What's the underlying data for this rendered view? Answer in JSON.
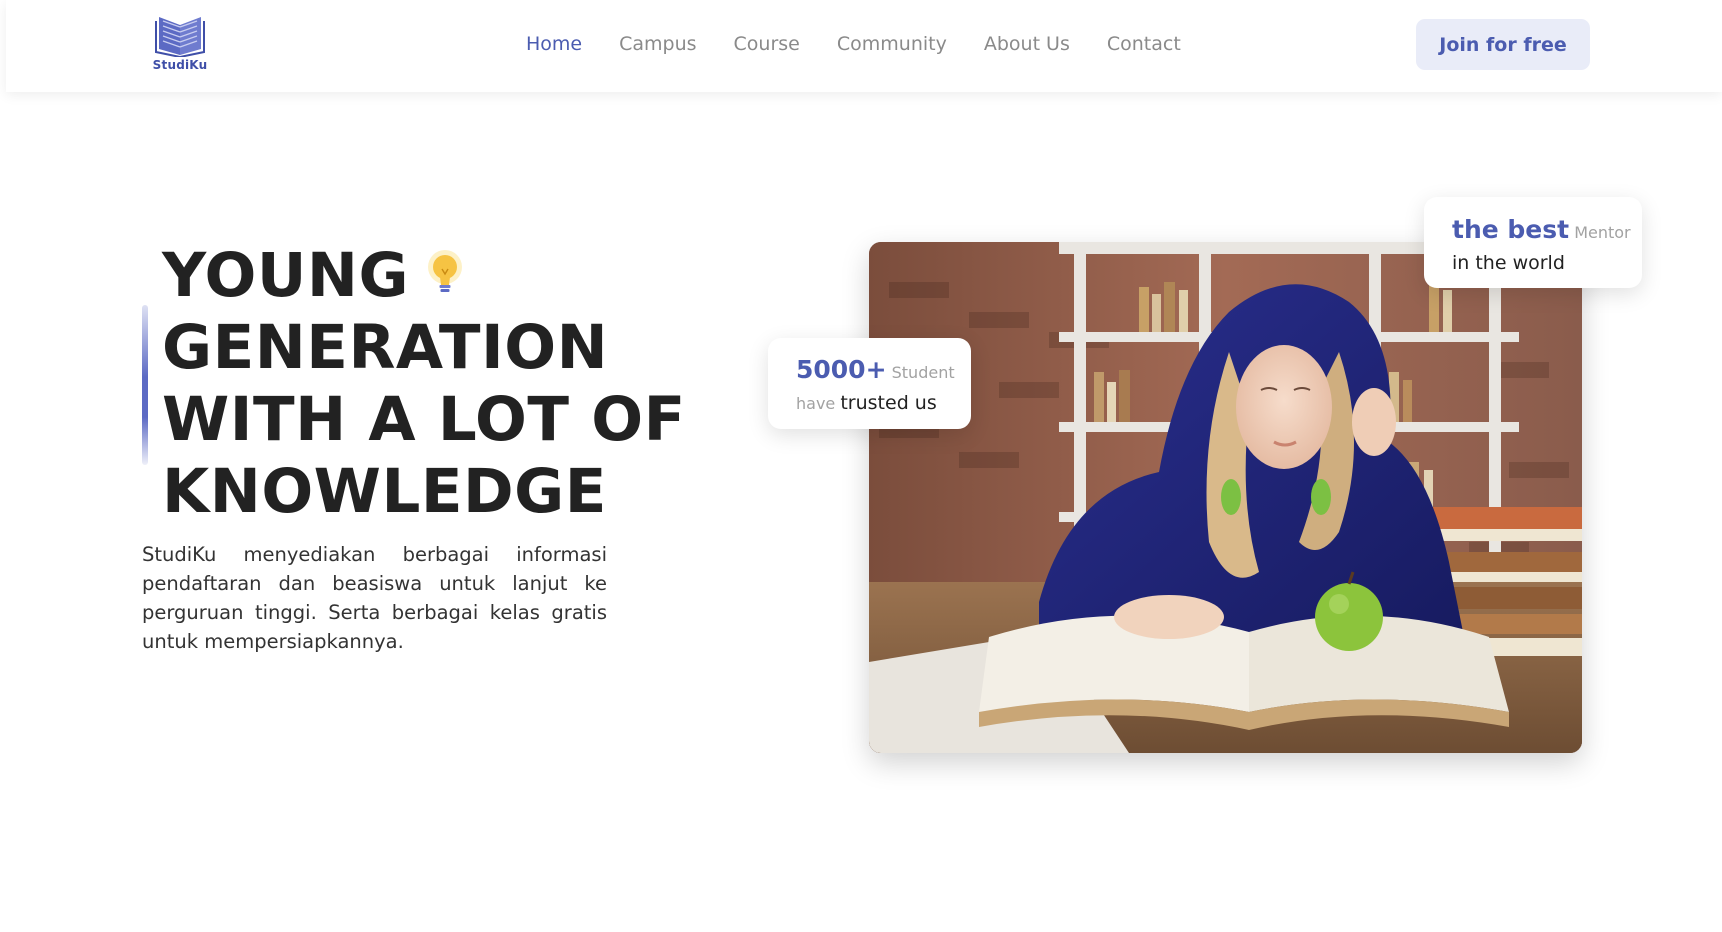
{
  "brand": {
    "name": "StudiKu",
    "icon": "open-book-icon",
    "accent_color": "#4b5cb0"
  },
  "nav": {
    "items": [
      {
        "label": "Home",
        "active": true
      },
      {
        "label": "Campus",
        "active": false
      },
      {
        "label": "Course",
        "active": false
      },
      {
        "label": "Community",
        "active": false
      },
      {
        "label": "About Us",
        "active": false
      },
      {
        "label": "Contact",
        "active": false
      }
    ],
    "cta_label": "Join for free"
  },
  "hero": {
    "title_lines": [
      "YOUNG",
      "GENERATION",
      "WITH A LOT OF",
      "KNOWLEDGE"
    ],
    "title_icon": "lightbulb-icon",
    "description": "StudiKu menyediakan berbagai informasi pendaftaran dan beasiswa untuk lanjut ke perguruan tinggi. Serta berbagai kelas gratis untuk mempersiapkannya.",
    "image": "student-reading-photo"
  },
  "cards": {
    "students": {
      "count": "5000+",
      "count_suffix": "Student",
      "line2_muted": "have",
      "line2_dark": "trusted us"
    },
    "mentor": {
      "highlight": "the best",
      "suffix": "Mentor",
      "line2": "in the world"
    }
  }
}
